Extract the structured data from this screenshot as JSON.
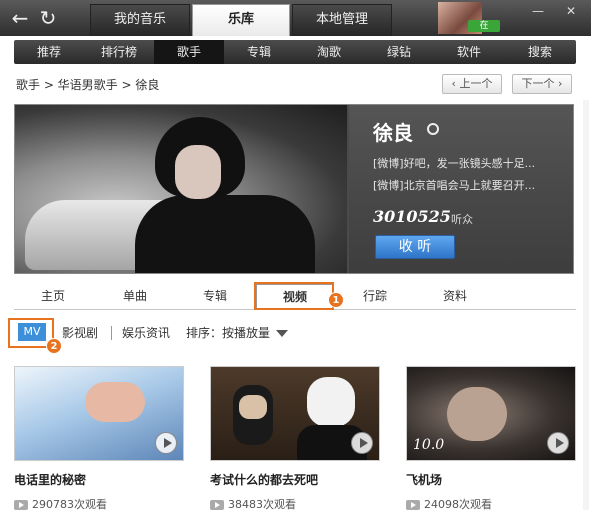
{
  "window": {
    "tabs": [
      {
        "label": "我的音乐"
      },
      {
        "label": "乐库"
      },
      {
        "label": "本地管理"
      }
    ],
    "status_badge": "在",
    "min_label": "—",
    "close_label": "✕"
  },
  "categories": [
    "推荐",
    "排行榜",
    "歌手",
    "专辑",
    "淘歌",
    "绿钻",
    "软件",
    "搜索"
  ],
  "breadcrumb": "歌手 > 华语男歌手 > 徐良",
  "pager": {
    "prev": "上一个",
    "next": "下一个"
  },
  "artist": {
    "name": "徐良",
    "weibo_lines": [
      "[微博]好吧，发一张镜头感十足...",
      "[微博]北京首唱会马上就要召开..."
    ],
    "fans_count": "3010525",
    "fans_label": "听众",
    "listen_label": "收 听"
  },
  "subtabs": [
    "主页",
    "单曲",
    "专辑",
    "视频",
    "行踪",
    "资料"
  ],
  "markers": [
    "1",
    "2"
  ],
  "filters": {
    "mv": "MV",
    "film": "影视剧",
    "news": "娱乐资讯",
    "sort_label": "排序：",
    "sort_value": "按播放量"
  },
  "videos": [
    {
      "title": "电话里的秘密",
      "plays": "290783次观看"
    },
    {
      "title": "考试什么的都去死吧",
      "plays": "38483次观看"
    },
    {
      "title": "飞机场",
      "plays": "24098次观看",
      "overlay": "10.0"
    }
  ],
  "colors": {
    "accent": "#e8731e",
    "button_blue": "#3c8fd8"
  }
}
